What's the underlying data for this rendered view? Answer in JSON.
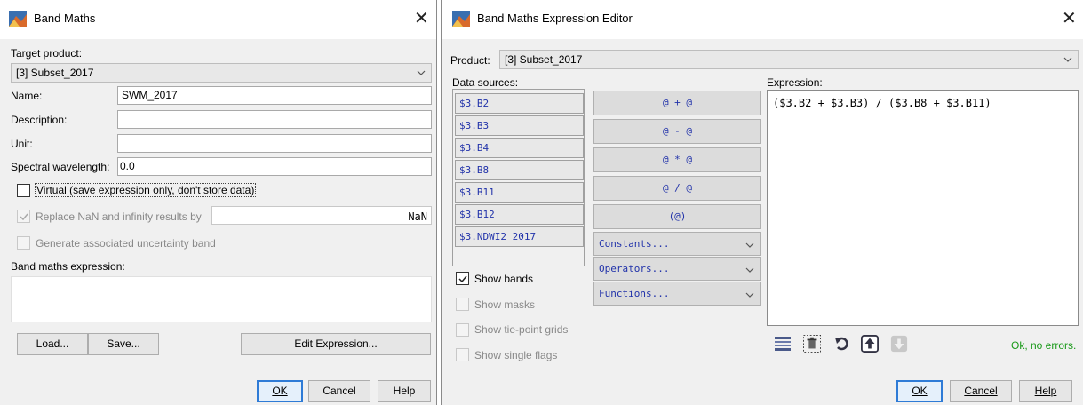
{
  "band_maths": {
    "title": "Band Maths",
    "target_product_label": "Target product:",
    "target_product_value": "[3] Subset_2017",
    "name_label": "Name:",
    "name_value": "SWM_2017",
    "description_label": "Description:",
    "description_value": "",
    "unit_label": "Unit:",
    "unit_value": "",
    "spectral_wavelength_label": "Spectral wavelength:",
    "spectral_wavelength_value": "0.0",
    "virtual_label": "Virtual (save expression only, don't store data)",
    "virtual_checked": false,
    "replace_nan_label": "Replace NaN and infinity results by",
    "replace_nan_value": "NaN",
    "replace_nan_checked": true,
    "uncertainty_label": "Generate associated uncertainty band",
    "expression_label": "Band maths expression:",
    "expression_value": "",
    "load_label": "Load...",
    "save_label": "Save...",
    "edit_expression_label": "Edit Expression...",
    "ok_label": "OK",
    "cancel_label": "Cancel",
    "help_label": "Help"
  },
  "editor": {
    "title": "Band Maths Expression Editor",
    "product_label": "Product:",
    "product_value": "[3] Subset_2017",
    "data_sources_label": "Data sources:",
    "data_sources": [
      "$3.B2",
      "$3.B3",
      "$3.B4",
      "$3.B8",
      "$3.B11",
      "$3.B12",
      "$3.NDWI2_2017"
    ],
    "operators": [
      "@ + @",
      "@ - @",
      "@ * @",
      "@ / @",
      "(@)"
    ],
    "dropdowns": [
      "Constants...",
      "Operators...",
      "Functions..."
    ],
    "show_bands_label": "Show bands",
    "show_bands_checked": true,
    "show_masks_label": "Show masks",
    "show_tie_point_label": "Show tie-point grids",
    "show_single_flags_label": "Show single flags",
    "expression_label": "Expression:",
    "expression_value": "($3.B2 + $3.B3) / ($3.B8 + $3.B11)",
    "status": "Ok, no errors.",
    "status_color": "#1a9a1a",
    "ok_label": "OK",
    "cancel_label": "Cancel",
    "help_label": "Help"
  },
  "colors": {
    "accent": "#2f7bd6",
    "link_blue": "#2233aa"
  }
}
